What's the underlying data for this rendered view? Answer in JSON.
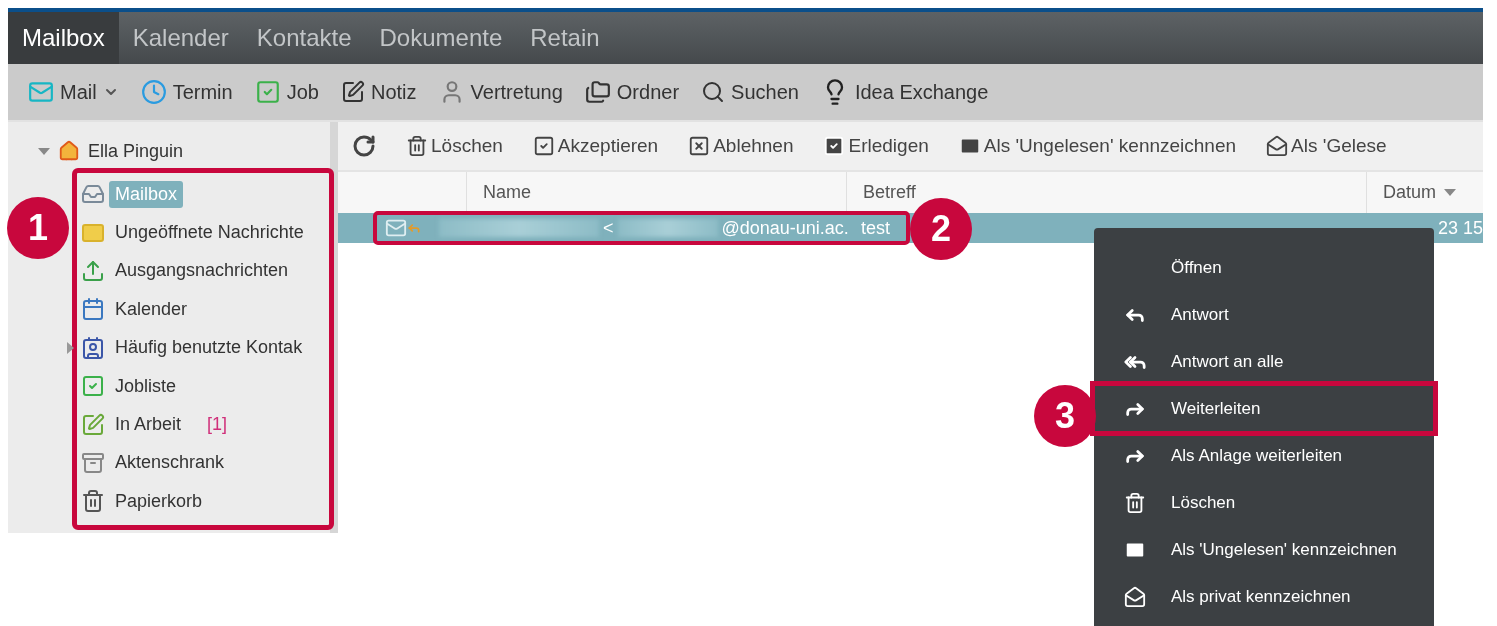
{
  "tabs": [
    {
      "label": "Mailbox",
      "selected": true
    },
    {
      "label": "Kalender",
      "selected": false
    },
    {
      "label": "Kontakte",
      "selected": false
    },
    {
      "label": "Dokumente",
      "selected": false
    },
    {
      "label": "Retain",
      "selected": false
    }
  ],
  "toolbar": [
    {
      "label": "Mail",
      "has_menu": true
    },
    {
      "label": "Termin",
      "has_menu": false
    },
    {
      "label": "Job",
      "has_menu": false
    },
    {
      "label": "Notiz",
      "has_menu": false
    },
    {
      "label": "Vertretung",
      "has_menu": false
    },
    {
      "label": "Ordner",
      "has_menu": false
    },
    {
      "label": "Suchen",
      "has_menu": false
    },
    {
      "label": "Idea Exchange",
      "has_menu": false
    }
  ],
  "sidebar": {
    "root": {
      "label": "Ella Pinguin",
      "expanded": true
    },
    "callout": "1",
    "folders": [
      {
        "label": "Mailbox",
        "selected": true,
        "collapsed": false
      },
      {
        "label": "Ungeöffnete Nachrichte",
        "selected": false,
        "collapsed": false
      },
      {
        "label": "Ausgangsnachrichten",
        "selected": false,
        "collapsed": false
      },
      {
        "label": "Kalender",
        "selected": false,
        "collapsed": false
      },
      {
        "label": "Häufig benutzte Kontak",
        "selected": false,
        "collapsed": true
      },
      {
        "label": "Jobliste",
        "selected": false,
        "collapsed": false
      },
      {
        "label": "In Arbeit",
        "selected": false,
        "collapsed": false,
        "badge": "[1]"
      },
      {
        "label": "Aktenschrank",
        "selected": false,
        "collapsed": false
      },
      {
        "label": "Papierkorb",
        "selected": false,
        "collapsed": false
      }
    ]
  },
  "actions": [
    {
      "label": "Löschen"
    },
    {
      "label": "Akzeptieren"
    },
    {
      "label": "Ablehnen"
    },
    {
      "label": "Erledigen"
    },
    {
      "label": "Als 'Ungelesen' kennzeichnen"
    },
    {
      "label": "Als 'Gelese"
    }
  ],
  "table": {
    "columns": [
      {
        "label": "Name",
        "sorted": false
      },
      {
        "label": "Betreff",
        "sorted": false
      },
      {
        "label": "Datum",
        "sorted": true
      }
    ],
    "rows": [
      {
        "selected": true,
        "replied": true,
        "name": "<",
        "email": "@donau-uni.ac.",
        "subject": "test",
        "date": "23 15",
        "callout": "2"
      }
    ]
  },
  "context_menu": [
    {
      "label": "Öffnen"
    },
    {
      "label": "Antwort"
    },
    {
      "label": "Antwort an alle"
    },
    {
      "label": "Weiterleiten",
      "callout": "3"
    },
    {
      "label": "Als Anlage weiterleiten"
    },
    {
      "label": "Löschen"
    },
    {
      "label": "Als 'Ungelesen' kennzeichnen"
    },
    {
      "label": "Als privat kennzeichnen"
    }
  ]
}
